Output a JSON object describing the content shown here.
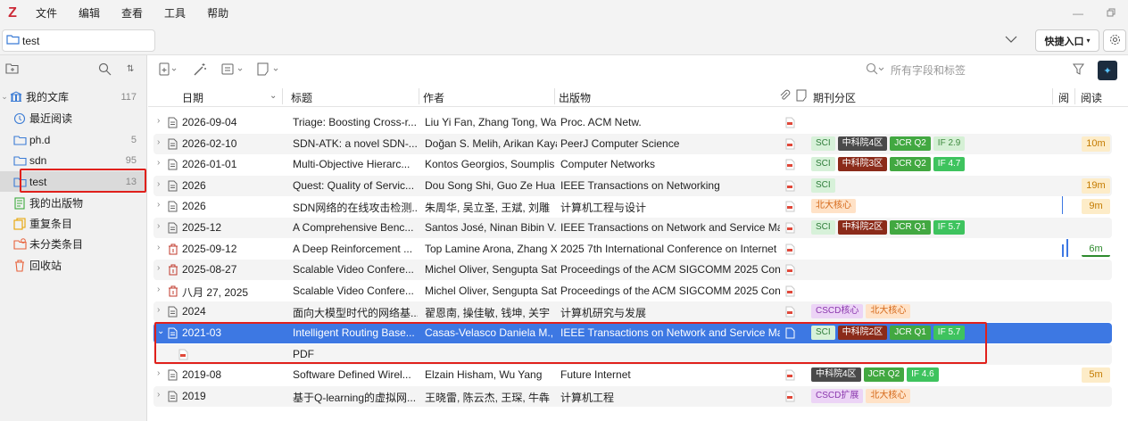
{
  "app": {
    "logo": "Z",
    "menu": [
      "文件",
      "编辑",
      "查看",
      "工具",
      "帮助"
    ]
  },
  "tabbar": {
    "tab_label": "test",
    "quick_entry": "快捷入口"
  },
  "sidebar": {
    "library": {
      "label": "我的文库",
      "count": "117"
    },
    "items": [
      {
        "label": "最近阅读",
        "count": "",
        "icon": "clock-icon"
      },
      {
        "label": "ph.d",
        "count": "5",
        "icon": "folder-icon"
      },
      {
        "label": "sdn",
        "count": "95",
        "icon": "folder-icon"
      },
      {
        "label": "test",
        "count": "13",
        "icon": "folder-icon"
      },
      {
        "label": "我的出版物",
        "count": "",
        "icon": "publications-icon"
      },
      {
        "label": "重复条目",
        "count": "",
        "icon": "duplicate-icon"
      },
      {
        "label": "未分类条目",
        "count": "",
        "icon": "unfiled-icon"
      },
      {
        "label": "回收站",
        "count": "",
        "icon": "trash-icon"
      }
    ]
  },
  "search": {
    "placeholder": "所有字段和标签"
  },
  "columns": {
    "date": "日期",
    "title": "标题",
    "author": "作者",
    "publication": "出版物",
    "partition": "期刊分区",
    "read1": "阅",
    "read2": "阅读"
  },
  "rows": [
    {
      "date": "2026-09-04",
      "title": "Triage: Boosting Cross-r...",
      "author": "Liu Yi Fan, Zhang Tong, Wang",
      "pub": "Proc. ACM Netw.",
      "badges": [],
      "readtime": ""
    },
    {
      "date": "2026-02-10",
      "title": "SDN-ATK: a novel SDN-...",
      "author": "Doğan S. Melih, Arikan Kaya",
      "pub": "PeerJ Computer Science",
      "badges": [
        [
          "SCI",
          "b-sci"
        ],
        [
          "中科院4区",
          "b-zk4"
        ],
        [
          "JCR Q2",
          "b-jcr"
        ],
        [
          "IF 2.9",
          "b-if29"
        ]
      ],
      "readtime": "10m"
    },
    {
      "date": "2026-01-01",
      "title": "Multi-Objective Hierarc...",
      "author": "Kontos Georgios, Soumplis P",
      "pub": "Computer Networks",
      "badges": [
        [
          "SCI",
          "b-sci"
        ],
        [
          "中科院3区",
          "b-zk"
        ],
        [
          "JCR Q2",
          "b-jcr"
        ],
        [
          "IF 4.7",
          "b-if"
        ]
      ],
      "readtime": ""
    },
    {
      "date": "2026",
      "title": "Quest: Quality of Servic...",
      "author": "Dou Song Shi, Guo Ze Hua",
      "pub": "IEEE Transactions on Networking",
      "badges": [
        [
          "SCI",
          "b-sci"
        ]
      ],
      "readtime": "19m"
    },
    {
      "date": "2026",
      "title": "SDN网络的在线攻击检测...",
      "author": "朱周华, 吴立圣, 王斌, 刘雕",
      "pub": "计算机工程与设计",
      "badges": [
        [
          "北大核心",
          "b-bd"
        ]
      ],
      "readtime": "9m"
    },
    {
      "date": "2025-12",
      "title": "A Comprehensive Benc...",
      "author": "Santos José, Ninan Bibin V., V",
      "pub": "IEEE Transactions on Network and Service Ma",
      "badges": [
        [
          "SCI",
          "b-sci"
        ],
        [
          "中科院2区",
          "b-zk"
        ],
        [
          "JCR Q1",
          "b-jcr"
        ],
        [
          "IF 5.7",
          "b-if"
        ]
      ],
      "readtime": ""
    },
    {
      "date": "2025-09-12",
      "title": "A Deep Reinforcement ...",
      "author": "Top Lamine Arona, Zhang Xi",
      "pub": "2025 7th International Conference on Internet",
      "badges": [],
      "readtime": "6m"
    },
    {
      "date": "2025-08-27",
      "title": "Scalable Video Confere...",
      "author": "Michel Oliver, Sengupta Sata",
      "pub": "Proceedings of the ACM SIGCOMM 2025 Con",
      "badges": [],
      "readtime": ""
    },
    {
      "date": "八月 27, 2025",
      "title": "Scalable Video Confere...",
      "author": "Michel Oliver, Sengupta Sata",
      "pub": "Proceedings of the ACM SIGCOMM 2025 Con",
      "badges": [],
      "readtime": ""
    },
    {
      "date": "2024",
      "title": "面向大模型时代的网络基...",
      "author": "翟恩南, 操佳敏, 钱坤, 关宇",
      "pub": "计算机研究与发展",
      "badges": [
        [
          "CSCD核心",
          "b-cscd"
        ],
        [
          "北大核心",
          "b-bd"
        ]
      ],
      "readtime": ""
    },
    {
      "date": "2021-03",
      "title": "Intelligent Routing Base...",
      "author": "Casas-Velasco Daniela M., Re",
      "pub": "IEEE Transactions on Network and Service Ma",
      "badges": [
        [
          "SCI",
          "b-sci"
        ],
        [
          "中科院2区",
          "b-zk"
        ],
        [
          "JCR Q1",
          "b-jcr"
        ],
        [
          "IF 5.7",
          "b-if"
        ]
      ],
      "readtime": ""
    },
    {
      "date": "",
      "title": "PDF",
      "author": "",
      "pub": "",
      "badges": [],
      "readtime": ""
    },
    {
      "date": "2019-08",
      "title": "Software Defined Wirel...",
      "author": "Elzain Hisham, Wu Yang",
      "pub": "Future Internet",
      "badges": [
        [
          "中科院4区",
          "b-zk4"
        ],
        [
          "JCR Q2",
          "b-jcr"
        ],
        [
          "IF 4.6",
          "b-if"
        ]
      ],
      "readtime": "5m"
    },
    {
      "date": "2019",
      "title": "基于Q-learning的虚拟网...",
      "author": "王晓雷, 陈云杰, 王琛, 牛犇",
      "pub": "计算机工程",
      "badges": [
        [
          "CSCD扩展",
          "b-cscdk"
        ],
        [
          "北大核心",
          "b-bd"
        ]
      ],
      "readtime": ""
    }
  ]
}
